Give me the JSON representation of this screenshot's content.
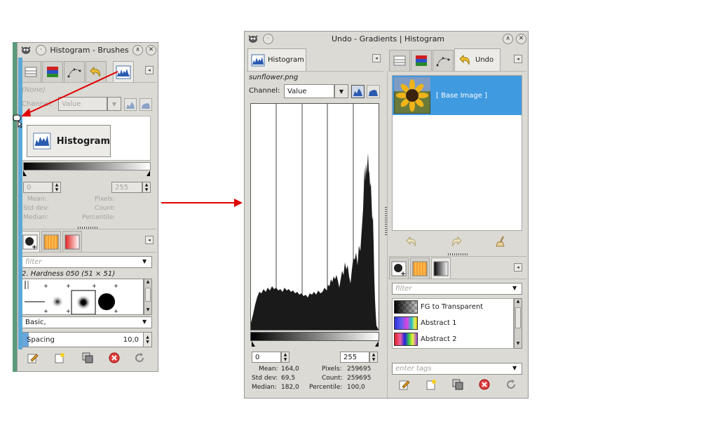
{
  "left_window": {
    "title": "Histogram - Brushes",
    "image_label": "(None)",
    "channel_label": "Channel:",
    "channel_value": "Value",
    "drag_button_label": "Histogram",
    "range_low": "0",
    "range_high": "255",
    "stats": {
      "mean_label": "Mean:",
      "std_label": "Std dev:",
      "median_label": "Median:",
      "pixels_label": "Pixels:",
      "count_label": "Count:",
      "percentile_label": "Percentile:"
    },
    "brushes": {
      "filter_placeholder": "filter",
      "selected_brush": "2. Hardness 050 (51 × 51)",
      "preset": "Basic,",
      "spacing_label": "Spacing",
      "spacing_value": "10,0",
      "spacing_fraction": 0.05
    }
  },
  "histogram_window": {
    "title": "Undo - Gradients | Histogram",
    "tab_label": "Histogram",
    "image_name": "sunflower.png",
    "channel_label": "Channel:",
    "channel_value": "Value",
    "range_low": "0",
    "range_high": "255",
    "stats": {
      "mean_label": "Mean:",
      "mean_value": "164,0",
      "std_label": "Std dev:",
      "std_value": "69,5",
      "median_label": "Median:",
      "median_value": "182,0",
      "pixels_label": "Pixels:",
      "pixels_value": "259695",
      "count_label": "Count:",
      "count_value": "259695",
      "percentile_label": "Percentile:",
      "percentile_value": "100,0"
    },
    "undo_tab_label": "Undo",
    "undo_items": [
      "[ Base Image ]"
    ],
    "gradients": {
      "filter_placeholder": "filter",
      "items": [
        "FG to Transparent",
        "Abstract 1",
        "Abstract 2"
      ],
      "tags_placeholder": "enter tags"
    }
  },
  "colors": {
    "selection": "#3f9ae0",
    "drag_arrow": "#e00000",
    "panel_bg": "#dcdad5",
    "histogram_fill": "#1a1a1a"
  },
  "icons": [
    "gimp-logo-icon",
    "histogram-icon",
    "layers-icon",
    "channels-icon",
    "paths-icon",
    "undo-icon",
    "brushes-icon",
    "patterns-icon",
    "gradients-icon",
    "edit-icon",
    "new-icon",
    "duplicate-icon",
    "delete-icon",
    "refresh-icon",
    "linear-histogram-icon",
    "log-histogram-icon",
    "redo-icon",
    "clear-history-icon"
  ]
}
